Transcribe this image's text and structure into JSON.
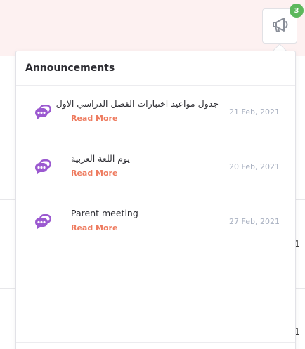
{
  "notification": {
    "badge_count": "3",
    "icon": "megaphone-icon",
    "accent": "#5cb85c"
  },
  "background": {
    "fragments": [
      "1",
      "1"
    ]
  },
  "panel": {
    "title": "Announcements",
    "items": [
      {
        "title": "جدول مواعيد اختبارات الفصل الدراسي الاول",
        "action": "Read More",
        "date": "21 Feb, 2021",
        "icon": "chat-bubbles-icon"
      },
      {
        "title": "يوم اللغة العربية",
        "action": "Read More",
        "date": "20 Feb, 2021",
        "icon": "chat-bubbles-icon"
      },
      {
        "title": "Parent meeting",
        "action": "Read More",
        "date": "27 Feb, 2021",
        "icon": "chat-bubbles-icon"
      }
    ]
  },
  "colors": {
    "icon_purple": "#9b59d0",
    "read_more": "#ee7b5f",
    "date": "#a9b1c1",
    "header_band": "#fdf1f1"
  }
}
